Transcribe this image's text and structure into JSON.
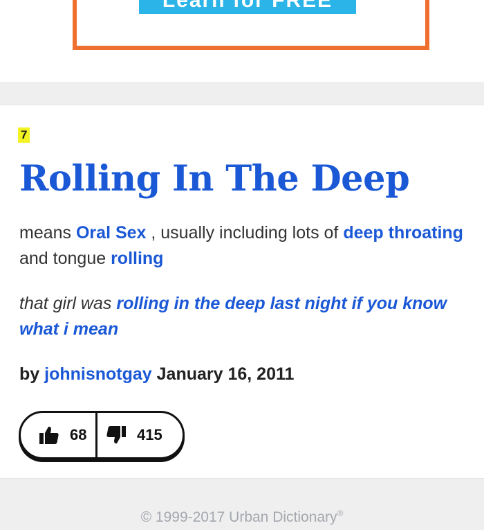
{
  "ad": {
    "button_label": "Learn for FREE"
  },
  "entry": {
    "rank": "7",
    "title": "Rolling In The Deep",
    "meaning": {
      "t1": "means ",
      "l1": "Oral Sex",
      "t2": " , usually including lots of ",
      "l2": "deep throating",
      "t3": " and tongue ",
      "l3": "rolling"
    },
    "example": {
      "t1": "that girl was ",
      "l1": "rolling in the deep last night if you know what i mean"
    },
    "byline": {
      "prefix": "by ",
      "author": "johnisnotgay",
      "date": "January 16, 2011"
    },
    "votes": {
      "up": "68",
      "down": "415"
    }
  },
  "footer": {
    "copyright": "© 1999-2017 Urban Dictionary",
    "reg_mark": "®"
  },
  "colors": {
    "link": "#1b58d6",
    "rank_highlight": "#f3f324",
    "ad_border": "#ef6f2e",
    "ad_button": "#2bb4e8"
  },
  "icons": {
    "upvote": "thumbs-up-icon",
    "downvote": "thumbs-down-icon"
  }
}
